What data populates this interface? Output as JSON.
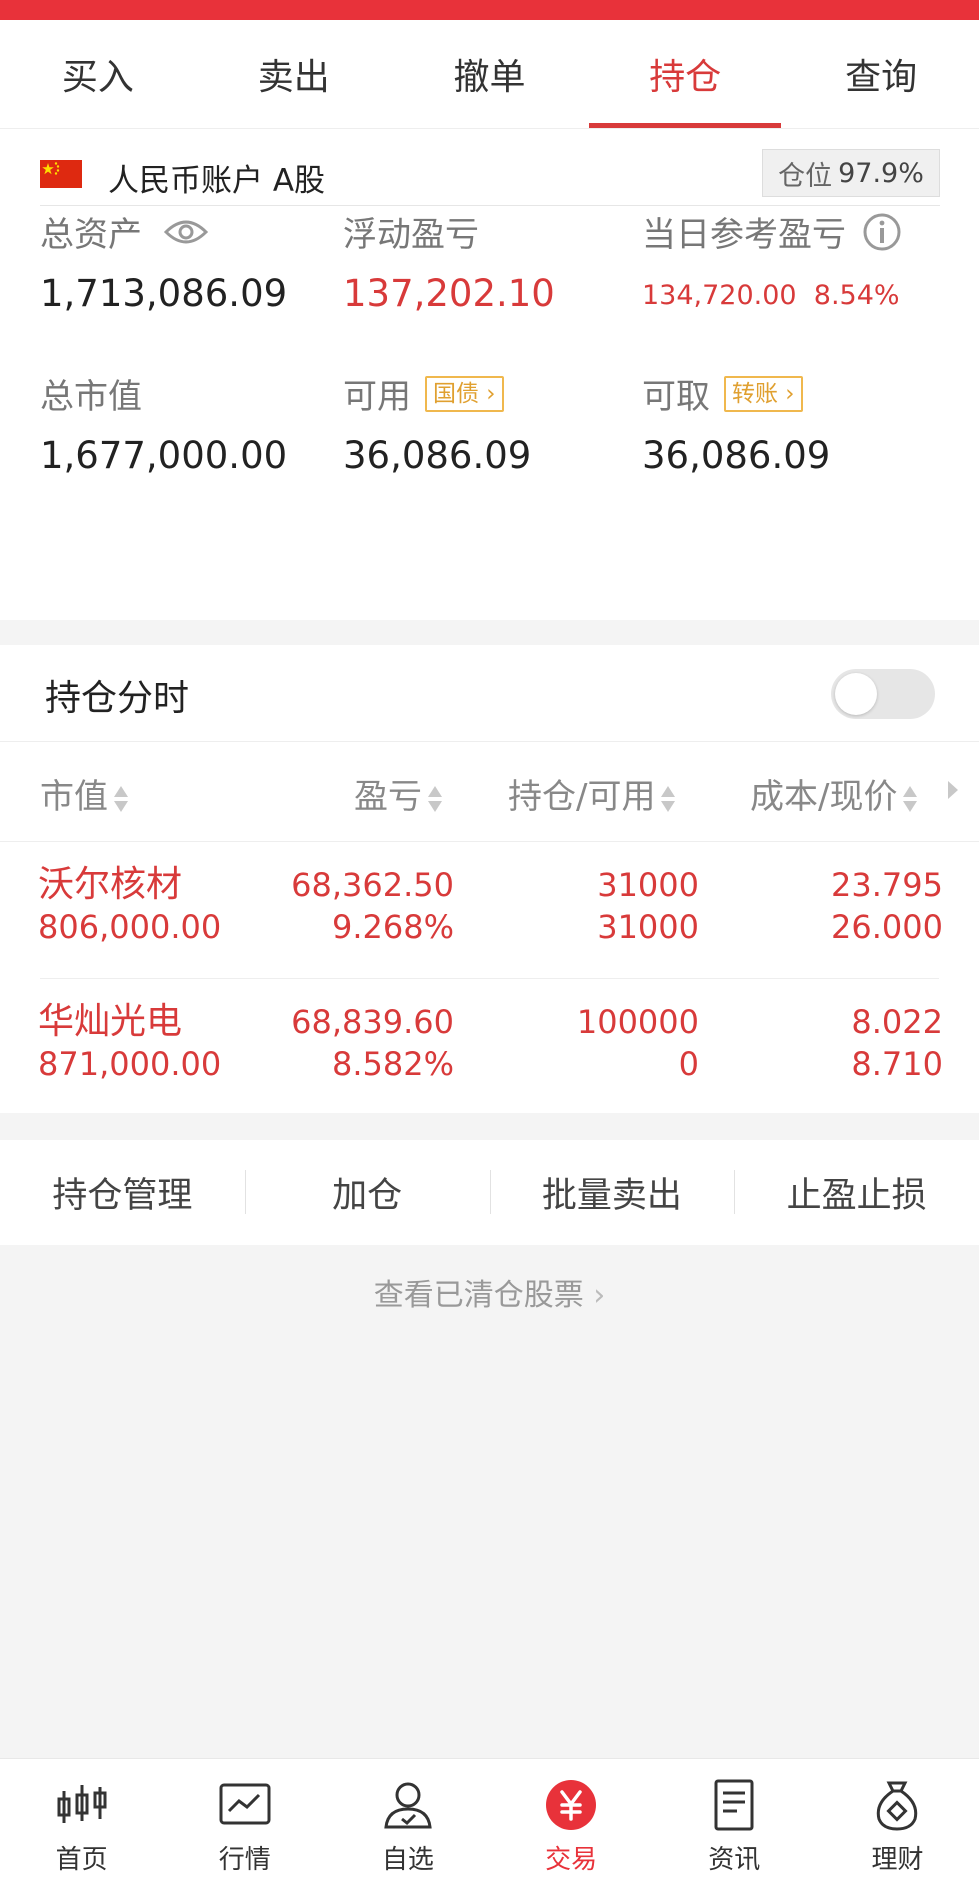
{
  "tabs": [
    {
      "label": "买入"
    },
    {
      "label": "卖出"
    },
    {
      "label": "撤单"
    },
    {
      "label": "持仓",
      "active": true
    },
    {
      "label": "查询"
    }
  ],
  "account": {
    "name": "人民币账户 A股",
    "position_label": "仓位",
    "position_value": "97.9%"
  },
  "metrics": {
    "total_assets_label": "总资产",
    "total_assets": "1,713,086.09",
    "float_pl_label": "浮动盈亏",
    "float_pl": "137,202.10",
    "today_pl_label": "当日参考盈亏",
    "today_pl": "134,720.00",
    "today_pl_pct": "8.54%",
    "market_value_label": "总市值",
    "market_value": "1,677,000.00",
    "available_label": "可用",
    "available_badge": "国债",
    "available": "36,086.09",
    "withdrawable_label": "可取",
    "withdrawable_badge": "转账",
    "withdrawable": "36,086.09"
  },
  "holdings": {
    "title": "持仓分时",
    "columns": [
      "市值",
      "盈亏",
      "持仓/可用",
      "成本/现价"
    ],
    "rows": [
      {
        "name": "沃尔核材",
        "market_value": "806,000.00",
        "pl": "68,362.50",
        "pl_pct": "9.268%",
        "position": "31000",
        "available": "31000",
        "cost": "23.795",
        "price": "26.000"
      },
      {
        "name": "华灿光电",
        "market_value": "871,000.00",
        "pl": "68,839.60",
        "pl_pct": "8.582%",
        "position": "100000",
        "available": "0",
        "cost": "8.022",
        "price": "8.710"
      }
    ]
  },
  "actions": [
    {
      "label": "持仓管理"
    },
    {
      "label": "加仓"
    },
    {
      "label": "批量卖出"
    },
    {
      "label": "止盈止损"
    }
  ],
  "cleared_link": "查看已清仓股票",
  "nav": [
    {
      "label": "首页",
      "icon": "candlestick-icon"
    },
    {
      "label": "行情",
      "icon": "chart-line-icon"
    },
    {
      "label": "自选",
      "icon": "user-star-icon"
    },
    {
      "label": "交易",
      "icon": "yuan-icon",
      "active": true
    },
    {
      "label": "资讯",
      "icon": "document-icon"
    },
    {
      "label": "理财",
      "icon": "money-bag-icon"
    }
  ],
  "colors": {
    "accent": "#e8323a",
    "gain": "#d83a3a",
    "badge": "#f0b84d"
  }
}
